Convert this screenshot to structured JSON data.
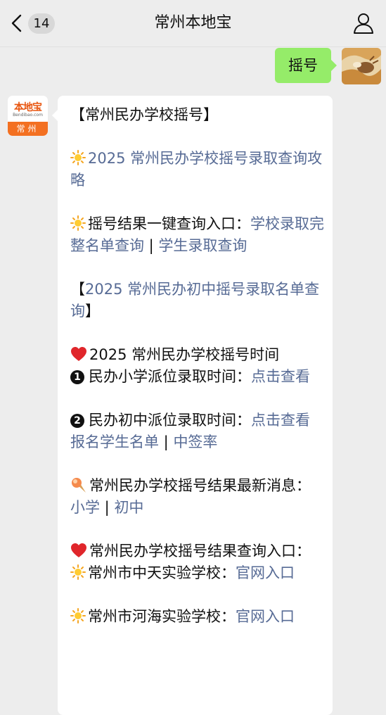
{
  "nav": {
    "unread_count": "14",
    "title": "常州本地宝"
  },
  "outgoing": {
    "text": "摇号"
  },
  "bot_avatar": {
    "brand": "本地宝",
    "sub": "Bendibao.com",
    "city": "常州"
  },
  "message": {
    "header": "【常州民办学校摇号】",
    "guide_link": "2025 常州民办学校摇号录取查询攻略",
    "result_label": "摇号结果一键查询入口：",
    "school_list_link": "学校录取完整名单查询",
    "sep": " | ",
    "student_link": "学生录取查询",
    "middle_open": "【",
    "middle_link": "2025 常州民办初中摇号录取名单查询",
    "middle_close": "】",
    "time_title": "2025 常州民办学校摇号时间",
    "primary_label": "民办小学派位录取时间：",
    "primary_link": "点击查看",
    "middle_time_label": "民办初中派位录取时间：",
    "middle_time_link": "点击查看",
    "reg_link": "报名学生名单",
    "rate_link": "中签率",
    "news_label": "常州民办学校摇号结果最新消息：",
    "news_primary": "小学",
    "news_middle": "初中",
    "query_title": "常州民办学校摇号结果查询入口：",
    "school1_label": "常州市中天实验学校：",
    "school1_link": "官网入口",
    "school2_label": "常州市河海实验学校：",
    "school2_link": "官网入口",
    "bullet1": "1",
    "bullet2": "2"
  },
  "colors": {
    "link": "#576b95",
    "bubble_out": "#95ec69",
    "background": "#ededed"
  }
}
